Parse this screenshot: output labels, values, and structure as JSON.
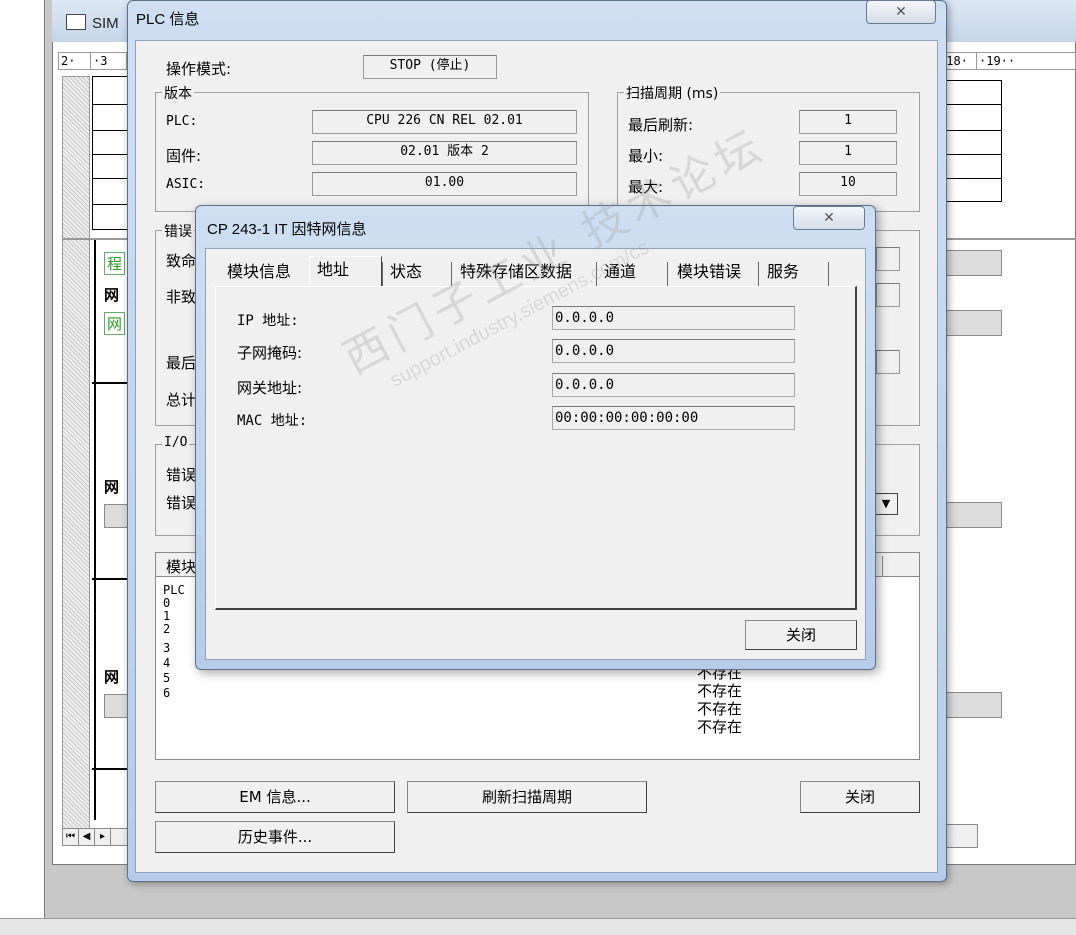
{
  "background_app": {
    "title_partial": "SIM",
    "ruler_left": [
      "2·",
      "·3"
    ],
    "ruler_right": [
      "·18·",
      "·19··"
    ],
    "side_labels": {
      "program": "程",
      "net1": "网",
      "net_box": "网",
      "net2": "网",
      "net3": "网"
    },
    "scroll_buttons": [
      "⏮",
      "◀",
      "▸"
    ]
  },
  "plc_window": {
    "title": "PLC 信息",
    "close_glyph": "✕",
    "mode_label": "操作模式:",
    "mode_value": "STOP (停止)",
    "version": {
      "group_title": "版本",
      "rows": [
        {
          "label": "PLC:",
          "value": "CPU 226 CN REL 02.01"
        },
        {
          "label": "固件:",
          "value": "02.01 版本 2"
        },
        {
          "label": "ASIC:",
          "value": "01.00"
        }
      ]
    },
    "scan": {
      "group_title": "扫描周期 (ms)",
      "rows": [
        {
          "label": "最后刷新:",
          "value": "1"
        },
        {
          "label": "最小:",
          "value": "1"
        },
        {
          "label": "最大:",
          "value": "10"
        }
      ]
    },
    "errors_group_title": "错误",
    "errors_partial": [
      "致命",
      "非致",
      "最后",
      "总计"
    ],
    "io_group_title": "I/O",
    "io_partial": [
      "错误",
      "错误"
    ],
    "dropdown_arrow": "▼",
    "module_list": {
      "header_partial": "模块",
      "rows": [
        "PLC",
        "0",
        "1",
        "2",
        "3",
        "4",
        "5",
        "6"
      ],
      "status_partial": [
        "不存在",
        "不存在",
        "不存在",
        "不存在"
      ]
    },
    "buttons": {
      "em_info": "EM 信息...",
      "refresh_scan": "刷新扫描周期",
      "close": "关闭",
      "history": "历史事件..."
    }
  },
  "cp_window": {
    "title": "CP 243-1 IT 因特网信息",
    "close_glyph": "✕",
    "tabs": [
      "模块信息",
      "地址",
      "状态",
      "特殊存储区数据",
      "通道",
      "模块错误",
      "服务"
    ],
    "active_tab": "地址",
    "fields": [
      {
        "label": "IP 地址:",
        "value": "0.0.0.0"
      },
      {
        "label": "子网掩码:",
        "value": "0.0.0.0"
      },
      {
        "label": "网关地址:",
        "value": "0.0.0.0"
      },
      {
        "label": "MAC 地址:",
        "value": "00:00:00:00:00:00"
      }
    ],
    "close_button": "关闭"
  },
  "watermark": {
    "line1": "西门子工业 技术论坛",
    "line2": "support.industry.siemens.com/cs"
  }
}
